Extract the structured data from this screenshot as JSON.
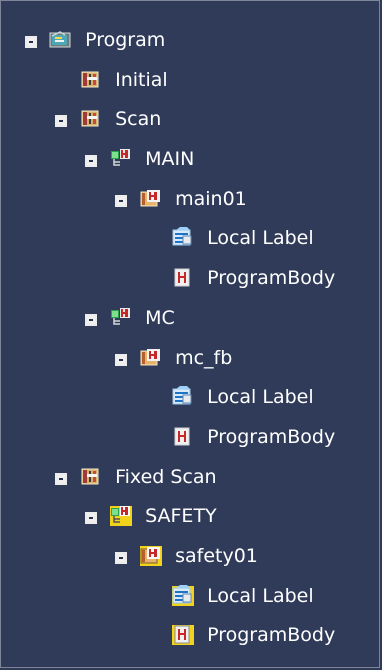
{
  "tree": {
    "program": {
      "label": "Program",
      "initial": {
        "label": "Initial"
      },
      "scan": {
        "label": "Scan",
        "main": {
          "label": "MAIN",
          "main01": {
            "label": "main01",
            "local_label": "Local Label",
            "program_body": "ProgramBody"
          }
        },
        "mc": {
          "label": "MC",
          "mc_fb": {
            "label": "mc_fb",
            "local_label": "Local Label",
            "program_body": "ProgramBody"
          }
        }
      },
      "fixed_scan": {
        "label": "Fixed Scan",
        "safety": {
          "label": "SAFETY",
          "safety01": {
            "label": "safety01",
            "local_label": "Local Label",
            "program_body": "ProgramBody"
          }
        }
      }
    }
  },
  "icons": {
    "program": "program-folder-icon",
    "initial": "program-block-icon",
    "scan": "program-block-icon",
    "main": "task-network-icon",
    "main01": "function-block-icon",
    "local_label": "local-label-icon",
    "program_body": "program-body-icon",
    "mc": "task-network-icon",
    "mc_fb": "function-block-icon",
    "fixed_scan": "program-block-icon",
    "safety": "safety-task-icon",
    "safety01": "safety-function-block-icon"
  },
  "colors": {
    "background": "#2f3b58",
    "text": "#ffffff",
    "expander": "#f0f0f0",
    "safety_accent": "#f2d31b"
  }
}
